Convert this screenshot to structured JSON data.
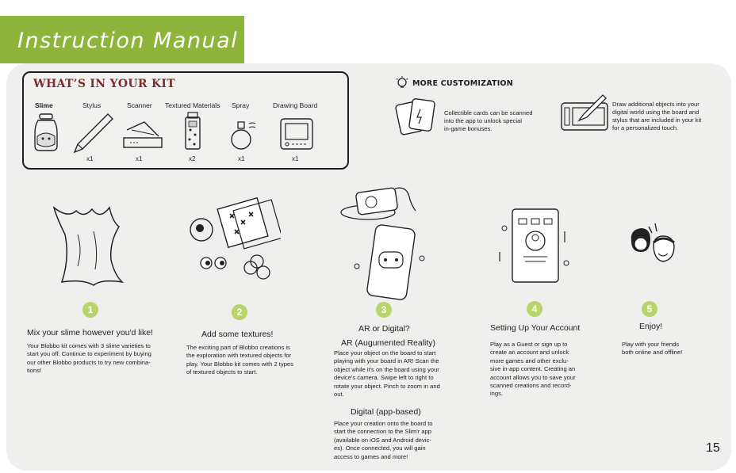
{
  "header": {
    "title": "Instruction Manual"
  },
  "kit": {
    "title": "WHAT’S IN YOUR KIT",
    "items": [
      {
        "label": "Slime",
        "qty": ""
      },
      {
        "label": "Stylus",
        "qty": "x1"
      },
      {
        "label": "Scanner",
        "qty": "x1"
      },
      {
        "label": "Textured Materials",
        "qty": "x2"
      },
      {
        "label": "Spray",
        "qty": "x1"
      },
      {
        "label": "Drawing Board",
        "qty": "x1"
      }
    ]
  },
  "customization": {
    "title": "MORE CUSTOMIZATION",
    "cards": {
      "lines": [
        "Collectible cards can be scanned",
        "into the app to unlock special",
        "in-game bonuses."
      ]
    },
    "board": {
      "lines": [
        "Draw additional objects into your",
        "digital world using the board and",
        "stylus that are included in your kit",
        "for a personalized touch."
      ]
    }
  },
  "steps": [
    {
      "number": "1",
      "title": "Mix your slime however you'd like!",
      "lines": [
        "Your Blobbo kit comes with 3 slime varieties to",
        "start you off. Continue to experiment by buying",
        "our other Blobbo products to try new combina-",
        "tions!"
      ]
    },
    {
      "number": "2",
      "title": "Add some textures!",
      "lines": [
        "The exciting part of Blobbo creations is",
        "the exploration with textured objects for",
        "play. Your Blobbo kit comes with 2 types",
        "of textured objects to start."
      ]
    },
    {
      "number": "3",
      "title": "AR or Digital?",
      "ar_title": "AR (Augumented Reality)",
      "ar_lines": [
        "Place your object on the board to start",
        "playing with your board in AR! Scan the",
        "object while it's on the board using your",
        "device's camera. Swipe left to right to",
        "rotate your object. Pinch to zoom in and",
        "out."
      ],
      "digital_title": "Digital (app-based)",
      "digital_lines": [
        "Place your creation onto the board to",
        "start the connection to the Slim'r app",
        "(available on iOS and Android devic-",
        "es). Once connected, you will gain",
        "access to games and more!"
      ]
    },
    {
      "number": "4",
      "title": "Setting Up Your Account",
      "lines": [
        "Play as a Guest or sign up to",
        "create an account and unlock",
        "more games and other exclu-",
        "sive in-app content. Creating an",
        "account allows you to save your",
        "scanned creations and record-",
        "ings."
      ]
    },
    {
      "number": "5",
      "title": "Enjoy!",
      "lines": [
        "Play with your friends",
        "both online and offline!"
      ]
    }
  ],
  "page_number": "15"
}
